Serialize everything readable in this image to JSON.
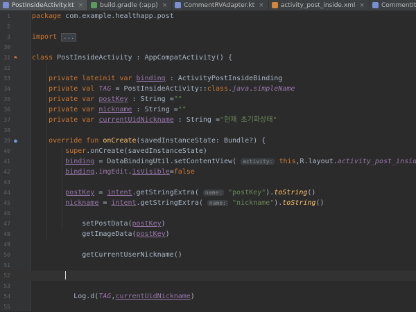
{
  "tabs": [
    {
      "label": "PostInsideActivity.kt",
      "color": "#7a8fd1",
      "active": true
    },
    {
      "label": "build.gradle (:app)",
      "color": "#5e9a5e",
      "active": false
    },
    {
      "label": "CommentRVAdapter.kt",
      "color": "#7a8fd1",
      "active": false
    },
    {
      "label": "activity_post_inside.xml",
      "color": "#d6863b",
      "active": false
    },
    {
      "label": "CommentItemModel.kt",
      "color": "#7a8fd1",
      "active": false
    }
  ],
  "close_glyph": "×",
  "lines": [
    {
      "n": "1",
      "html": "<span class=\"kw\">package</span> com.example.healthapp.post"
    },
    {
      "n": "2",
      "html": ""
    },
    {
      "n": "3",
      "html": "<span class=\"kw\">import</span> <span class=\"fold\">...</span>"
    },
    {
      "n": "30",
      "html": ""
    },
    {
      "n": "31",
      "html": "<span class=\"kw\">class</span> PostInsideActivity : AppCompatActivity() {"
    },
    {
      "n": "32",
      "html": ""
    },
    {
      "n": "33",
      "html": "    <span class=\"kw\">private lateinit var</span> <span class=\"prop ul\">binding</span> : ActivityPostInsideBinding"
    },
    {
      "n": "34",
      "html": "    <span class=\"kw\">private val</span> <span class=\"prop it\">TAG</span> = PostInsideActivity::<span class=\"kw\">class</span>.<span class=\"prop it\">java</span>.<span class=\"prop it\">simpleName</span>"
    },
    {
      "n": "35",
      "html": "    <span class=\"kw\">private var</span> <span class=\"prop ul\">postKey</span> : String =<span class=\"str\">\"\"</span>"
    },
    {
      "n": "36",
      "html": "    <span class=\"kw\">private var</span> <span class=\"prop ul\">nickname</span> : String =<span class=\"str\">\"\"</span>"
    },
    {
      "n": "37",
      "html": "    <span class=\"kw\">private var</span> <span class=\"prop ul\">currentUidNickname</span> : String =<span class=\"str\">\"현재 초기화상태\"</span>"
    },
    {
      "n": "38",
      "html": ""
    },
    {
      "n": "39",
      "html": "    <span class=\"kw\">override fun</span> <span class=\"fn\">onCreate</span>(savedInstanceState: Bundle?) {"
    },
    {
      "n": "40",
      "html": "        <span class=\"kw\">super</span>.onCreate(savedInstanceState)"
    },
    {
      "n": "41",
      "html": "        <span class=\"prop ul\">binding</span> = DataBindingUtil.setContentView( <span class=\"hint\">activity:</span> <span class=\"kw\">this</span>,R.layout.<span class=\"prop it\">activity_post_inside</span>)"
    },
    {
      "n": "42",
      "html": "        <span class=\"prop ul\">binding</span>.<span class=\"prop\">imgEdit</span>.<span class=\"prop ul\">isVisible</span>=<span class=\"kw\">false</span>"
    },
    {
      "n": "43",
      "html": ""
    },
    {
      "n": "44",
      "html": "        <span class=\"prop ul\">postKey</span> = <span class=\"prop ul\">intent</span>.getStringExtra( <span class=\"hint\">name:</span> <span class=\"str\">\"postKey\"</span>).<span class=\"fn it\">toString</span>()"
    },
    {
      "n": "45",
      "html": "        <span class=\"prop ul\">nickname</span> = <span class=\"prop ul\">intent</span>.getStringExtra( <span class=\"hint\">name:</span> <span class=\"str\">\"nickname\"</span>).<span class=\"fn it\">toString</span>()"
    },
    {
      "n": "46",
      "html": ""
    },
    {
      "n": "47",
      "html": "            setPostData(<span class=\"prop ul\">postKey</span>)"
    },
    {
      "n": "48",
      "html": "            getImageData(<span class=\"prop ul\">postKey</span>)"
    },
    {
      "n": "49",
      "html": ""
    },
    {
      "n": "50",
      "html": "            getCurrentUserNickname()"
    },
    {
      "n": "51",
      "html": ""
    },
    {
      "n": "52",
      "html": "        <span class=\"caret\" data-name=\"text-caret\"></span>",
      "current": true
    },
    {
      "n": "53",
      "html": ""
    },
    {
      "n": "54",
      "html": "          Log.d(<span class=\"prop it\">TAG</span>,<span class=\"prop ul\">currentUidNickname</span>)"
    },
    {
      "n": "55",
      "html": ""
    }
  ],
  "gutter_icons": {
    "class_run": "⚑",
    "override": "●"
  }
}
